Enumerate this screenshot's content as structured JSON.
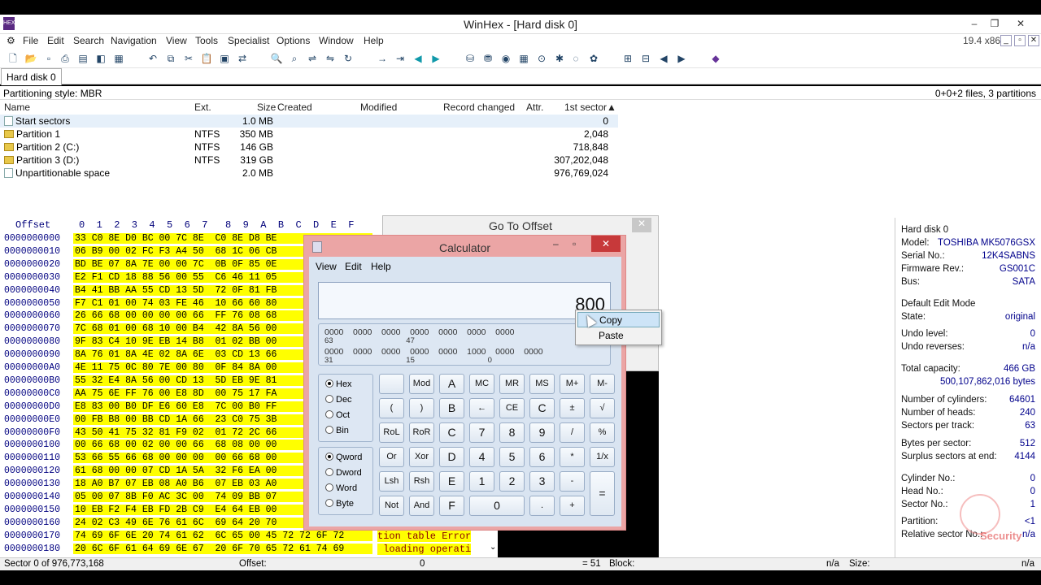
{
  "window": {
    "title": "WinHex - [Hard disk 0]",
    "version": "19.4 x86",
    "minimize": "–",
    "maximize": "❐",
    "close": "✕"
  },
  "menu": [
    "File",
    "Edit",
    "Search",
    "Navigation",
    "View",
    "Tools",
    "Specialist",
    "Options",
    "Window",
    "Help"
  ],
  "tab": "Hard disk 0",
  "info": {
    "partitioning": "Partitioning style: MBR",
    "summary": "0+0+2 files, 3 partitions"
  },
  "list": {
    "columns": [
      "Name",
      "Ext.",
      "Size",
      "Created",
      "Modified",
      "Record changed",
      "Attr.",
      "1st sector▲"
    ],
    "rows": [
      {
        "name": "Start sectors",
        "ext": "",
        "size": "1.0 MB",
        "sector": "0",
        "icon": "page"
      },
      {
        "name": "Partition 1",
        "ext": "NTFS",
        "size": "350 MB",
        "sector": "2,048",
        "icon": "folder"
      },
      {
        "name": "Partition 2 (C:)",
        "ext": "NTFS",
        "size": "146 GB",
        "sector": "718,848",
        "icon": "folder"
      },
      {
        "name": "Partition 3 (D:)",
        "ext": "NTFS",
        "size": "319 GB",
        "sector": "307,202,048",
        "icon": "folder"
      },
      {
        "name": "Unpartitionable space",
        "ext": "",
        "size": "2.0 MB",
        "sector": "976,769,024",
        "icon": "page"
      }
    ]
  },
  "hex": {
    "header_offset": "Offset",
    "header_cols": "0  1  2  3  4  5  6  7   8  9  A  B  C  D  E  F",
    "rows": [
      {
        "off": "0000000000",
        "bytes": "33 C0 8E D0 BC 00 7C 8E  C0 8E D8 BE"
      },
      {
        "off": "0000000010",
        "bytes": "06 B9 00 02 FC F3 A4 50  68 1C 06 CB"
      },
      {
        "off": "0000000020",
        "bytes": "BD BE 07 8A 7E 00 00 7C  0B 0F 85 0E"
      },
      {
        "off": "0000000030",
        "bytes": "E2 F1 CD 18 88 56 00 55  C6 46 11 05"
      },
      {
        "off": "0000000040",
        "bytes": "B4 41 BB AA 55 CD 13 5D  72 0F 81 FB"
      },
      {
        "off": "0000000050",
        "bytes": "F7 C1 01 00 74 03 FE 46  10 66 60 80"
      },
      {
        "off": "0000000060",
        "bytes": "26 66 68 00 00 00 00 66  FF 76 08 68"
      },
      {
        "off": "0000000070",
        "bytes": "7C 68 01 00 68 10 00 B4  42 8A 56 00"
      },
      {
        "off": "0000000080",
        "bytes": "9F 83 C4 10 9E EB 14 B8  01 02 BB 00"
      },
      {
        "off": "0000000090",
        "bytes": "8A 76 01 8A 4E 02 8A 6E  03 CD 13 66"
      },
      {
        "off": "00000000A0",
        "bytes": "4E 11 75 0C 80 7E 00 80  0F 84 8A 00"
      },
      {
        "off": "00000000B0",
        "bytes": "55 32 E4 8A 56 00 CD 13  5D EB 9E 81"
      },
      {
        "off": "00000000C0",
        "bytes": "AA 75 6E FF 76 00 E8 8D  00 75 17 FA"
      },
      {
        "off": "00000000D0",
        "bytes": "E8 83 00 B0 DF E6 60 E8  7C 00 B0 FF"
      },
      {
        "off": "00000000E0",
        "bytes": "00 FB B8 00 BB CD 1A 66  23 C0 75 3B"
      },
      {
        "off": "00000000F0",
        "bytes": "43 50 41 75 32 81 F9 02  01 72 2C 66"
      },
      {
        "off": "0000000100",
        "bytes": "00 66 68 00 02 00 00 66  68 08 00 00"
      },
      {
        "off": "0000000110",
        "bytes": "53 66 55 66 68 00 00 00  00 66 68 00"
      },
      {
        "off": "0000000120",
        "bytes": "61 68 00 00 07 CD 1A 5A  32 F6 EA 00"
      },
      {
        "off": "0000000130",
        "bytes": "18 A0 B7 07 EB 08 A0 B6  07 EB 03 A0"
      },
      {
        "off": "0000000140",
        "bytes": "05 00 07 8B F0 AC 3C 00  74 09 BB 07"
      },
      {
        "off": "0000000150",
        "bytes": "10 EB F2 F4 EB FD 2B C9  E4 64 EB 00"
      },
      {
        "off": "0000000160",
        "bytes": "24 02 C3 49 6E 76 61 6C  69 64 20 70"
      },
      {
        "off": "0000000170",
        "bytes": "74 69 6F 6E 20 74 61 62  6C 65 00 45 72 72 6F 72"
      },
      {
        "off": "0000000180",
        "bytes": "20 6C 6F 61 64 69 6E 67  20 6F 70 65 72 61 74 69"
      }
    ],
    "text_rows": [
      "tion table Error",
      " loading operati"
    ]
  },
  "goto": {
    "title": "Go To Offset",
    "close": "✕"
  },
  "calculator": {
    "title": "Calculator",
    "menu": [
      "View",
      "Edit",
      "Help"
    ],
    "display": "800",
    "bits": {
      "row1": "0000    0000    0000    0000    0000    0000    0000",
      "row1_sub": "63                                  47",
      "row2": "0000    0000    0000    0000    0000    1000    0000    0000",
      "row2_sub": "31                                  15                                  0"
    },
    "base_modes": [
      "Hex",
      "Dec",
      "Oct",
      "Bin"
    ],
    "word_modes": [
      "Qword",
      "Dword",
      "Word",
      "Byte"
    ],
    "keys": [
      [
        "",
        "Mod",
        "A",
        "MC",
        "MR",
        "MS",
        "M+",
        "M-"
      ],
      [
        "(",
        ")",
        "B",
        "←",
        "CE",
        "C",
        "±",
        "√"
      ],
      [
        "RoL",
        "RoR",
        "C",
        "7",
        "8",
        "9",
        "/",
        "%"
      ],
      [
        "Or",
        "Xor",
        "D",
        "4",
        "5",
        "6",
        "*",
        "1/x"
      ],
      [
        "Lsh",
        "Rsh",
        "E",
        "1",
        "2",
        "3",
        "-",
        "="
      ],
      [
        "Not",
        "And",
        "F",
        "0",
        "",
        ".",
        "+",
        ""
      ]
    ]
  },
  "context_menu": [
    "Copy",
    "Paste"
  ],
  "details": [
    {
      "label": "Hard disk 0",
      "value": ""
    },
    {
      "label": "Model:",
      "value": "TOSHIBA MK5076GSX"
    },
    {
      "label": "Serial No.:",
      "value": "12K4SABNS"
    },
    {
      "label": "Firmware Rev.:",
      "value": "GS001C"
    },
    {
      "label": "Bus:",
      "value": "SATA"
    },
    {
      "label": "Default Edit Mode",
      "value": ""
    },
    {
      "label": "State:",
      "value": "original"
    },
    {
      "label": "Undo level:",
      "value": "0"
    },
    {
      "label": "Undo reverses:",
      "value": "n/a"
    },
    {
      "label": "Total capacity:",
      "value": "466 GB"
    },
    {
      "label": "",
      "value": "500,107,862,016 bytes"
    },
    {
      "label": "Number of cylinders:",
      "value": "64601"
    },
    {
      "label": "Number of heads:",
      "value": "240"
    },
    {
      "label": "Sectors per track:",
      "value": "63"
    },
    {
      "label": "Bytes per sector:",
      "value": "512"
    },
    {
      "label": "Surplus sectors at end:",
      "value": "4144"
    },
    {
      "label": "Cylinder No.:",
      "value": "0"
    },
    {
      "label": "Head No.:",
      "value": "0"
    },
    {
      "label": "Sector No.:",
      "value": "1"
    },
    {
      "label": "Partition:",
      "value": "<1"
    },
    {
      "label": "Relative sector No.:",
      "value": "n/a"
    }
  ],
  "status": {
    "sector": "Sector 0 of 976,773,168",
    "offset_label": "Offset:",
    "offset_value": "0",
    "eq": "= 51",
    "block_label": "Block:",
    "block_value": "n/a",
    "size_label": "Size:",
    "size_value": "n/a"
  },
  "watermark": "Security"
}
